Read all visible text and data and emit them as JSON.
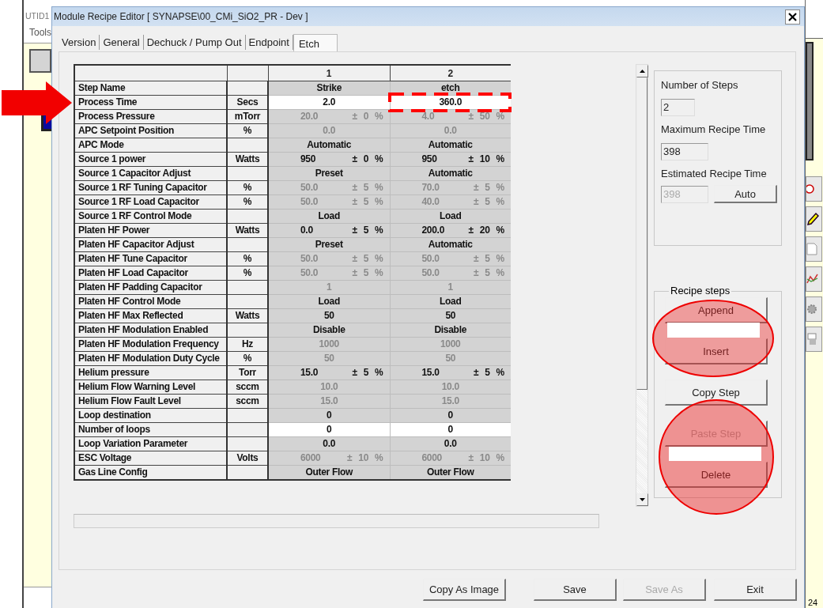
{
  "background_window": {
    "title": "UTID1",
    "menu": [
      "Tools"
    ],
    "status": "24"
  },
  "window": {
    "title": "Module Recipe Editor [ SYNAPSE\\00_CMi_SiO2_PR - Dev ]"
  },
  "tabs": [
    {
      "label": "Version",
      "selected": false
    },
    {
      "label": "General",
      "selected": false
    },
    {
      "label": "Dechuck / Pump Out",
      "selected": false
    },
    {
      "label": "Endpoint",
      "selected": false
    },
    {
      "label": "Etch",
      "selected": true
    }
  ],
  "table": {
    "step_headers": [
      "1",
      "2"
    ],
    "rows": [
      {
        "name": "Step Name",
        "steps": [
          {
            "value": "Strike",
            "kind": "plain"
          },
          {
            "value": "etch",
            "kind": "plain"
          }
        ]
      },
      {
        "name": "Process Time",
        "unit": "Secs",
        "steps": [
          {
            "value": "2.0",
            "kind": "input"
          },
          {
            "value": "360.0",
            "kind": "input"
          }
        ]
      },
      {
        "name": "Process Pressure",
        "unit": "mTorr",
        "steps": [
          {
            "value": "20.0",
            "tolerance": "± 0 %",
            "kind": "disabled"
          },
          {
            "value": "4.0",
            "tolerance": "± 50 %",
            "kind": "disabled"
          }
        ]
      },
      {
        "name": "APC Setpoint Position",
        "unit": "%",
        "steps": [
          {
            "value": "0.0",
            "kind": "disabled"
          },
          {
            "value": "0.0",
            "kind": "disabled"
          }
        ]
      },
      {
        "name": "APC Mode",
        "steps": [
          {
            "value": "Automatic",
            "kind": "plain"
          },
          {
            "value": "Automatic",
            "kind": "plain"
          }
        ]
      },
      {
        "name": "Source 1 power",
        "unit": "Watts",
        "steps": [
          {
            "value": "950",
            "tolerance": "± 0 %",
            "kind": "plain"
          },
          {
            "value": "950",
            "tolerance": "± 10 %",
            "kind": "plain"
          }
        ]
      },
      {
        "name": "Source 1 Capacitor Adjust",
        "steps": [
          {
            "value": "Preset",
            "kind": "plain"
          },
          {
            "value": "Automatic",
            "kind": "plain"
          }
        ]
      },
      {
        "name": "Source 1 RF Tuning Capacitor",
        "unit": "%",
        "steps": [
          {
            "value": "50.0",
            "tolerance": "± 5 %",
            "kind": "disabled"
          },
          {
            "value": "70.0",
            "tolerance": "± 5 %",
            "kind": "disabled"
          }
        ]
      },
      {
        "name": "Source 1 RF Load Capacitor",
        "unit": "%",
        "steps": [
          {
            "value": "50.0",
            "tolerance": "± 5 %",
            "kind": "disabled"
          },
          {
            "value": "40.0",
            "tolerance": "± 5 %",
            "kind": "disabled"
          }
        ]
      },
      {
        "name": "Source 1 RF Control Mode",
        "steps": [
          {
            "value": "Load",
            "kind": "plain"
          },
          {
            "value": "Load",
            "kind": "plain"
          }
        ]
      },
      {
        "name": "Platen HF Power",
        "unit": "Watts",
        "steps": [
          {
            "value": "0.0",
            "tolerance": "± 5 %",
            "kind": "plain"
          },
          {
            "value": "200.0",
            "tolerance": "± 20 %",
            "kind": "plain"
          }
        ]
      },
      {
        "name": "Platen HF Capacitor Adjust",
        "steps": [
          {
            "value": "Preset",
            "kind": "plain"
          },
          {
            "value": "Automatic",
            "kind": "plain"
          }
        ]
      },
      {
        "name": "Platen HF Tune Capacitor",
        "unit": "%",
        "steps": [
          {
            "value": "50.0",
            "tolerance": "± 5 %",
            "kind": "disabled"
          },
          {
            "value": "50.0",
            "tolerance": "± 5 %",
            "kind": "disabled"
          }
        ]
      },
      {
        "name": "Platen HF Load Capacitor",
        "unit": "%",
        "steps": [
          {
            "value": "50.0",
            "tolerance": "± 5 %",
            "kind": "disabled"
          },
          {
            "value": "50.0",
            "tolerance": "± 5 %",
            "kind": "disabled"
          }
        ]
      },
      {
        "name": "Platen HF Padding Capacitor",
        "steps": [
          {
            "value": "1",
            "kind": "disabled"
          },
          {
            "value": "1",
            "kind": "disabled"
          }
        ]
      },
      {
        "name": "Platen HF Control Mode",
        "steps": [
          {
            "value": "Load",
            "kind": "plain"
          },
          {
            "value": "Load",
            "kind": "plain"
          }
        ]
      },
      {
        "name": "Platen HF Max Reflected",
        "unit": "Watts",
        "steps": [
          {
            "value": "50",
            "kind": "plain"
          },
          {
            "value": "50",
            "kind": "plain"
          }
        ]
      },
      {
        "name": "Platen HF Modulation Enabled",
        "steps": [
          {
            "value": "Disable",
            "kind": "plain"
          },
          {
            "value": "Disable",
            "kind": "plain"
          }
        ]
      },
      {
        "name": "Platen HF Modulation Frequency",
        "unit": "Hz",
        "steps": [
          {
            "value": "1000",
            "kind": "disabled"
          },
          {
            "value": "1000",
            "kind": "disabled"
          }
        ]
      },
      {
        "name": "Platen HF Modulation Duty Cycle",
        "unit": "%",
        "steps": [
          {
            "value": "50",
            "kind": "disabled"
          },
          {
            "value": "50",
            "kind": "disabled"
          }
        ]
      },
      {
        "name": "Helium pressure",
        "unit": "Torr",
        "steps": [
          {
            "value": "15.0",
            "tolerance": "± 5 %",
            "kind": "plain"
          },
          {
            "value": "15.0",
            "tolerance": "± 5 %",
            "kind": "plain"
          }
        ]
      },
      {
        "name": "Helium Flow Warning Level",
        "unit": "sccm",
        "steps": [
          {
            "value": "10.0",
            "kind": "disabled"
          },
          {
            "value": "10.0",
            "kind": "disabled"
          }
        ]
      },
      {
        "name": "Helium Flow Fault Level",
        "unit": "sccm",
        "steps": [
          {
            "value": "15.0",
            "kind": "disabled"
          },
          {
            "value": "15.0",
            "kind": "disabled"
          }
        ]
      },
      {
        "name": "Loop destination",
        "steps": [
          {
            "value": "0",
            "kind": "plain"
          },
          {
            "value": "0",
            "kind": "plain"
          }
        ]
      },
      {
        "name": "Number of loops",
        "steps": [
          {
            "value": "0",
            "kind": "input"
          },
          {
            "value": "0",
            "kind": "input"
          }
        ]
      },
      {
        "name": "Loop Variation Parameter",
        "steps": [
          {
            "value": "0.0",
            "kind": "plain"
          },
          {
            "value": "0.0",
            "kind": "plain"
          }
        ]
      },
      {
        "name": "ESC Voltage",
        "unit": "Volts",
        "steps": [
          {
            "value": "6000",
            "tolerance": "± 10 %",
            "kind": "disabled"
          },
          {
            "value": "6000",
            "tolerance": "± 10 %",
            "kind": "disabled"
          }
        ]
      },
      {
        "name": "Gas Line Config",
        "steps": [
          {
            "value": "Outer Flow",
            "kind": "plain"
          },
          {
            "value": "Outer Flow",
            "kind": "plain"
          }
        ]
      }
    ]
  },
  "summary": {
    "fields": [
      {
        "label": "Number of Steps",
        "value": "2",
        "disabled": false
      },
      {
        "label": "Maximum Recipe Time",
        "value": "398",
        "disabled": false
      },
      {
        "label": "Estimated Recipe Time",
        "value": "398",
        "disabled": true
      }
    ],
    "auto_button": "Auto"
  },
  "recipe_steps": {
    "title": "Recipe steps",
    "buttons": [
      {
        "label": "Append",
        "disabled": false
      },
      {
        "label": "Insert",
        "disabled": false
      },
      {
        "label": "Copy Step",
        "disabled": false
      },
      {
        "label": "Paste Step",
        "disabled": true
      },
      {
        "label": "Delete",
        "disabled": false
      }
    ]
  },
  "footer_buttons": [
    {
      "label": "Copy As Image",
      "disabled": false
    },
    {
      "label": "Save",
      "disabled": false
    },
    {
      "label": "Save As",
      "disabled": true
    },
    {
      "label": "Exit",
      "disabled": false
    }
  ]
}
